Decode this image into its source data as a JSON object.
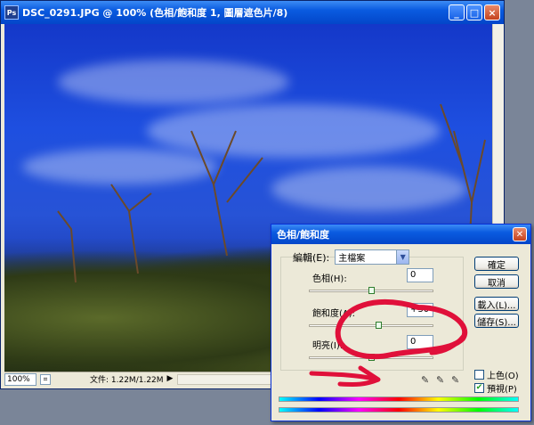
{
  "document_window": {
    "title": "DSC_0291.JPG @ 100% (色相/飽和度 1, 圖層遮色片/8)",
    "app_icon": "Ps",
    "buttons": {
      "minimize": "_",
      "maximize": "□",
      "close": "×"
    },
    "status": {
      "zoom": "100%",
      "file_info": "文件: 1.22M/1.22M",
      "arrow": "▶"
    }
  },
  "dialog": {
    "title": "色相/飽和度",
    "edit_label": "編輯(E):",
    "edit_value": "主檔案",
    "params": [
      {
        "label": "色相(H):",
        "value": "0",
        "level": 0.5
      },
      {
        "label": "飽和度(A):",
        "value": "+30",
        "level": 0.56
      },
      {
        "label": "明亮(I):",
        "value": "0",
        "level": 0.5
      }
    ],
    "buttons": {
      "ok": "確定",
      "cancel": "取消",
      "load": "載入(L)...",
      "save": "儲存(S)..."
    },
    "colorize": {
      "label": "上色(O)",
      "checked": false
    },
    "preview": {
      "label": "預視(P)",
      "checked": true
    },
    "icons": [
      "eyedropper-icon",
      "eyedropper-plus-icon",
      "eyedropper-minus-icon"
    ]
  },
  "colors": {
    "annotation_ink": "#e0103a",
    "titlebar": "#0a5be0"
  }
}
